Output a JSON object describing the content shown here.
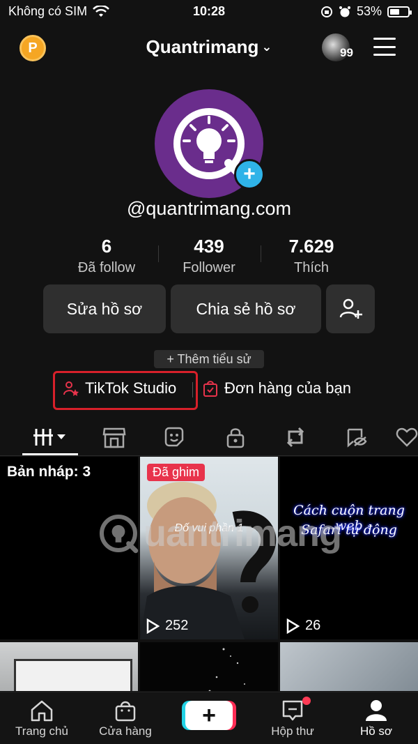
{
  "status_bar": {
    "carrier": "Không có SIM",
    "time": "10:28",
    "battery": "53%",
    "battery_level": 0.53
  },
  "header": {
    "coin_label": "P",
    "username": "Quantrimang",
    "notification_count": "99"
  },
  "profile": {
    "handle": "@quantrimang.com",
    "add_icon": "+"
  },
  "stats": [
    {
      "value": "6",
      "label": "Đã follow"
    },
    {
      "value": "439",
      "label": "Follower"
    },
    {
      "value": "7.629",
      "label": "Thích"
    }
  ],
  "actions": {
    "edit_profile": "Sửa hồ sơ",
    "share_profile": "Chia sẻ hồ sơ"
  },
  "bio": {
    "add_bio": "+ Thêm tiểu sử"
  },
  "links": {
    "studio": "TikTok Studio",
    "orders": "Đơn hàng của bạn"
  },
  "tabs": [
    "grid-icon",
    "shop-icon",
    "sticker-icon",
    "lock-icon",
    "repost-icon",
    "hidden-icon",
    "heart-icon"
  ],
  "grid": {
    "draft_label": "Bản nháp: 3",
    "pinned_label": "Đã ghim",
    "pinned_overlay": "Đố vui phần 1",
    "pinned_views": "252",
    "third_overlay_line1": "Cách cuộn trang web",
    "third_overlay_line2": "Safari tự động",
    "third_views": "26"
  },
  "watermark": "uantrimang",
  "bottom_nav": {
    "home": "Trang chủ",
    "shop": "Cửa hàng",
    "create": "+",
    "inbox": "Hộp thư",
    "profile": "Hồ sơ"
  },
  "colors": {
    "accent_red": "#d8202a",
    "brand_purple": "#6a2d8c",
    "add_blue": "#2fb3e8",
    "pinned_badge": "#e8334b"
  }
}
